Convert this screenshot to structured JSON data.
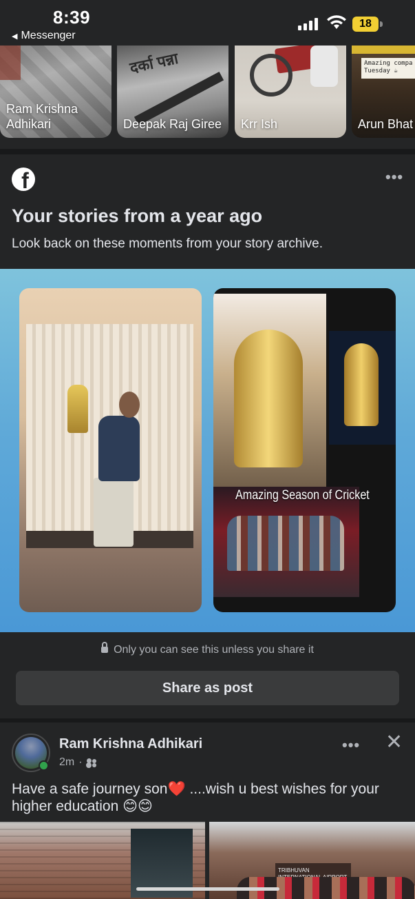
{
  "status_bar": {
    "time": "8:39",
    "back_app": "Messenger",
    "battery": "18"
  },
  "stories": [
    {
      "name": "Ram Krishna Adhikari"
    },
    {
      "name": "Deepak Raj Giree"
    },
    {
      "name": "Krr Ish"
    },
    {
      "name": "Arun Bhat"
    }
  ],
  "story_note": "Amazing compa Tuesday ☕",
  "story_deva_text": "दर्का पन्ना",
  "memory": {
    "title": "Your stories from a year ago",
    "subtitle": "Look back on these moments from your story archive.",
    "caption": "Amazing Season of Cricket",
    "privacy": "Only you can see this unless you share it",
    "share_label": "Share as post",
    "more": "•••"
  },
  "post": {
    "author": "Ram Krishna Adhikari",
    "time": "2m",
    "separator": "·",
    "text": "Have a safe journey son❤️ ....wish u  best wishes for your higher education 😊😊",
    "more": "•••",
    "close": "✕",
    "photo_sign": "TRIBHUVAN INTERNATIONAL AIRPORT"
  },
  "colors": {
    "background": "#242526",
    "divider": "#18191a",
    "text": "#e4e6eb",
    "secondary_text": "#b0b3b8",
    "button_bg": "#3a3b3c",
    "online": "#31a24c",
    "battery": "#f2cf33"
  },
  "icons": [
    "facebook-icon",
    "lock-icon",
    "friends-icon",
    "more-icon",
    "close-icon",
    "signal-icon",
    "wifi-icon",
    "battery-icon"
  ]
}
